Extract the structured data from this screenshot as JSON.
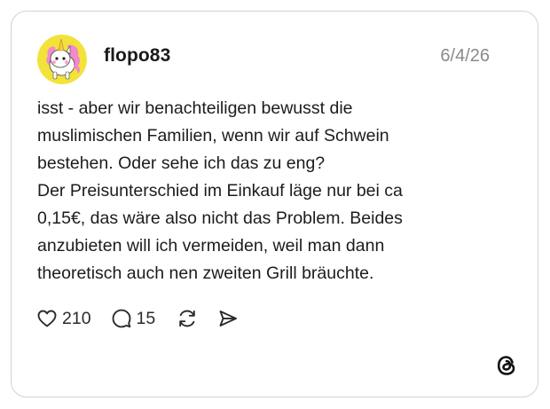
{
  "post": {
    "username": "flopo83",
    "date": "6/4/26",
    "text_lines": [
      "isst - aber wir benachteiligen bewusst die",
      "muslimischen Familien, wenn wir auf Schwein",
      "bestehen. Oder sehe ich das zu eng?",
      "Der Preisunterschied im Einkauf läge nur bei ca",
      "0,15€, das wäre also nicht das Problem. Beides",
      "anzubieten will ich vermeiden, weil man dann",
      "theoretisch auch nen zweiten Grill bräuchte."
    ],
    "avatar_icon": "unicorn-avatar",
    "colors": {
      "avatar_bg": "#f3e23a",
      "accent_pink": "#f08ac8",
      "username": "#1a1a1a",
      "date": "#8a8a8a"
    }
  },
  "actions": {
    "likes": "210",
    "replies": "15",
    "like_icon": "heart-icon",
    "reply_icon": "comment-icon",
    "repost_icon": "repost-icon",
    "share_icon": "share-icon"
  },
  "branding": {
    "logo_icon": "threads-logo-icon"
  }
}
